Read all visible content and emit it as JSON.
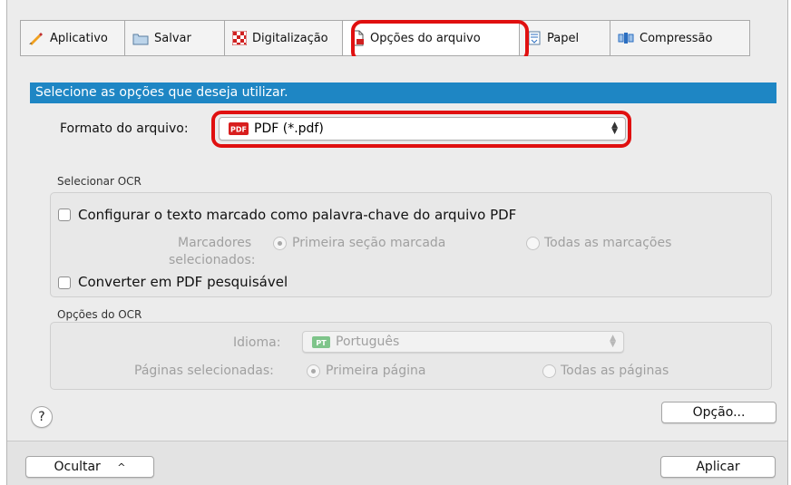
{
  "tabs": [
    {
      "label": "Aplicativo",
      "icon": "pencil-icon"
    },
    {
      "label": "Salvar",
      "icon": "folder-icon"
    },
    {
      "label": "Digitalização",
      "icon": "scan-checker-icon"
    },
    {
      "label": "Opções do arquivo",
      "icon": "file-options-icon",
      "active": true
    },
    {
      "label": "Papel",
      "icon": "paper-icon"
    },
    {
      "label": "Compressão",
      "icon": "compression-icon"
    }
  ],
  "banner": "Selecione as opções que deseja utilizar.",
  "file_format": {
    "label": "Formato do arquivo:",
    "value": "PDF (*.pdf)",
    "badge": "PDF"
  },
  "ocr_select": {
    "title": "Selecionar OCR",
    "keyword_checkbox": "Configurar o texto marcado como palavra-chave do arquivo PDF",
    "markers_label_1": "Marcadores",
    "markers_label_2": "selecionados:",
    "radio_first": "Primeira seção marcada",
    "radio_all": "Todas as marcações",
    "searchable_checkbox": "Converter em PDF pesquisável"
  },
  "ocr_options": {
    "title": "Opções do OCR",
    "language_label": "Idioma:",
    "language_value": "Português",
    "language_badge": "PT",
    "pages_label": "Páginas selecionadas:",
    "radio_first": "Primeira página",
    "radio_all": "Todas as páginas"
  },
  "help_label": "?",
  "option_button": "Opção...",
  "hide_button": "Ocultar",
  "hide_chevron": "^",
  "apply_button": "Aplicar",
  "colors": {
    "accent": "#1e86c4",
    "highlight": "#e01010"
  }
}
